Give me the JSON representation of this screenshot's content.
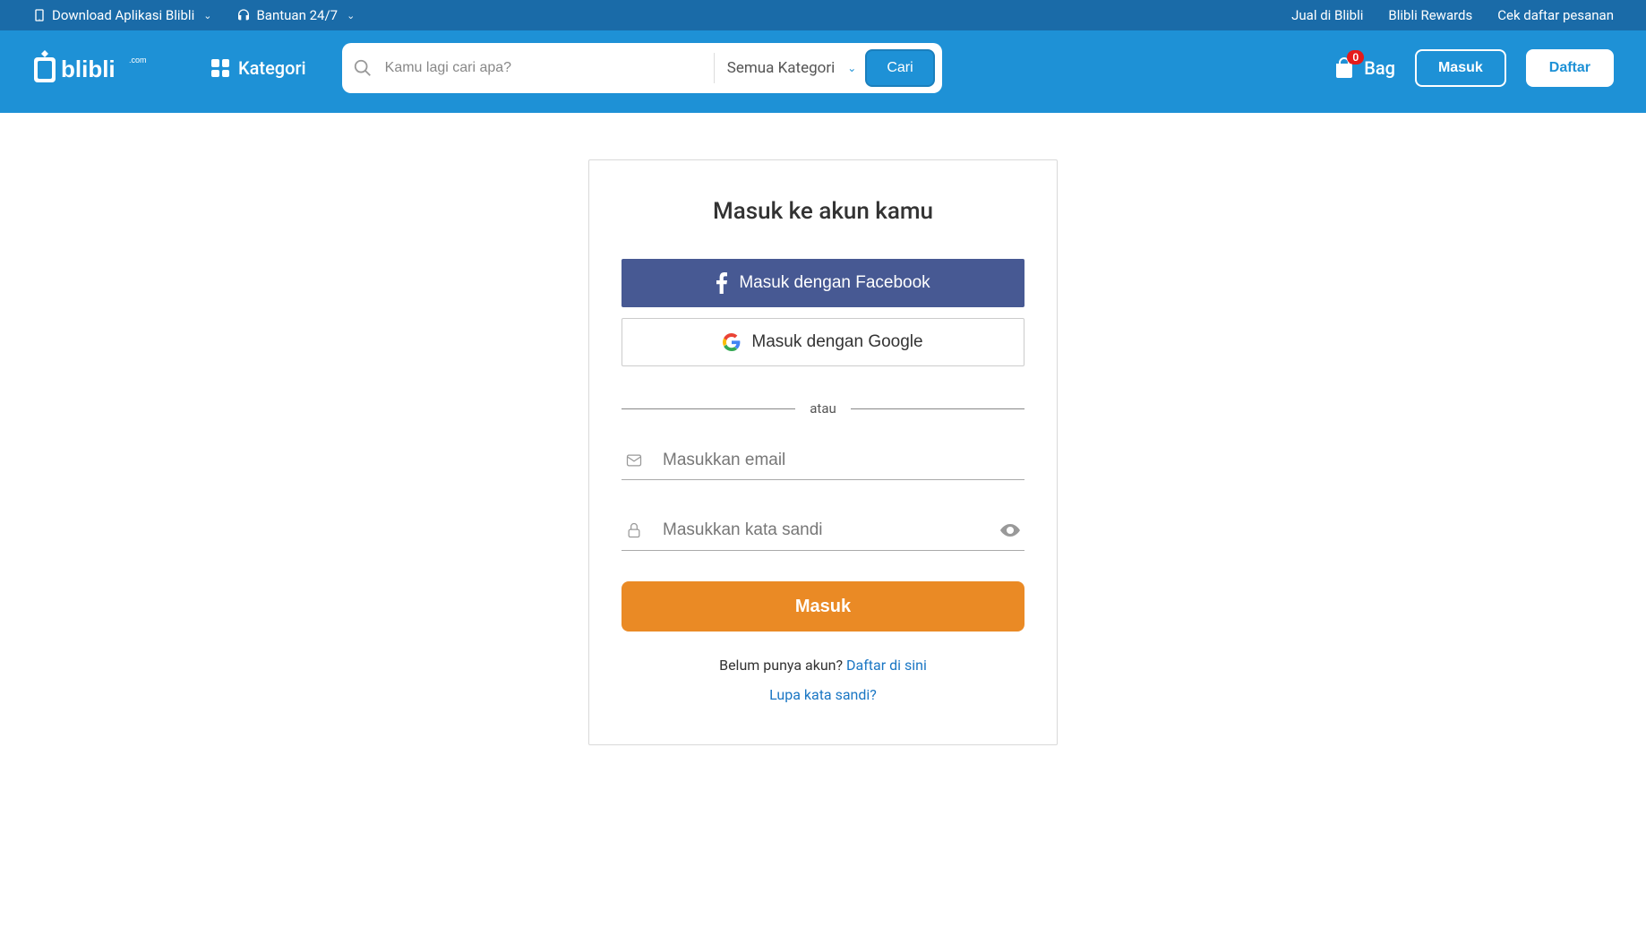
{
  "topbar": {
    "download": "Download Aplikasi Blibli",
    "help": "Bantuan 24/7",
    "sell": "Jual di Blibli",
    "rewards": "Blibli Rewards",
    "track": "Cek daftar pesanan"
  },
  "nav": {
    "kategori": "Kategori",
    "search_placeholder": "Kamu lagi cari apa?",
    "category_all": "Semua Kategori",
    "search_btn": "Cari",
    "bag_label": "Bag",
    "bag_count": "0",
    "login": "Masuk",
    "register": "Daftar"
  },
  "login": {
    "title": "Masuk ke akun kamu",
    "facebook": "Masuk dengan Facebook",
    "google": "Masuk dengan Google",
    "or": "atau",
    "email_placeholder": "Masukkan email",
    "password_placeholder": "Masukkan kata sandi",
    "submit": "Masuk",
    "no_account": "Belum punya akun? ",
    "register_here": "Daftar di sini",
    "forgot": "Lupa kata sandi?"
  }
}
